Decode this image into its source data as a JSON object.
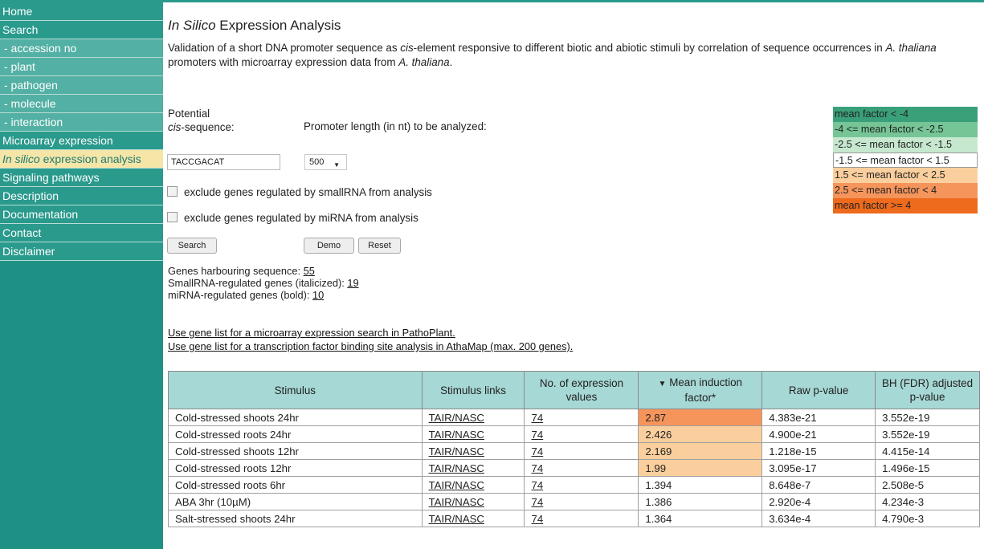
{
  "nav": {
    "items": [
      {
        "label": "Home",
        "sub": false
      },
      {
        "label": "Search",
        "sub": false
      },
      {
        "label": "- accession no",
        "sub": true
      },
      {
        "label": "- plant",
        "sub": true
      },
      {
        "label": "- pathogen",
        "sub": true
      },
      {
        "label": "- molecule",
        "sub": true
      },
      {
        "label": "- interaction",
        "sub": true
      },
      {
        "label": "Microarray expression",
        "sub": false
      },
      {
        "label_italic": "In silico",
        "label_rest": " expression analysis",
        "active": true
      },
      {
        "label": "Signaling pathways",
        "sub": false
      },
      {
        "label": "Description",
        "sub": false
      },
      {
        "label": "Documentation",
        "sub": false
      },
      {
        "label": "Contact",
        "sub": false
      },
      {
        "label": "Disclaimer",
        "sub": false
      }
    ]
  },
  "page": {
    "title_italic": "In Silico",
    "title_rest": " Expression Analysis",
    "intro": {
      "p1": "Validation of a short DNA promoter sequence as ",
      "p2": "cis",
      "p3": "-element responsive to different biotic and abiotic stimuli by correlation of sequence occurrences in ",
      "p4": "A. thaliana",
      "p5": " promoters with microarray expression data from ",
      "p6": "A. thaliana",
      "p7": "."
    }
  },
  "form": {
    "seq_label_1": "Potential",
    "seq_label_2_italic": "cis",
    "seq_label_2_rest": "-sequence:",
    "length_label": "Promoter length (in nt) to be analyzed:",
    "sequence_value": "TACCGACAT",
    "length_value": "500",
    "exclude_smallrna": "exclude genes regulated by smallRNA from analysis",
    "exclude_mirna": "exclude genes regulated by miRNA from analysis",
    "search_btn": "Search",
    "demo_btn": "Demo",
    "reset_btn": "Reset"
  },
  "stats": {
    "harbouring_label": "Genes harbouring sequence: ",
    "harbouring_value": "55",
    "smallrna_label": "SmallRNA-regulated genes (italicized): ",
    "smallrna_value": "19",
    "mirna_label": "miRNA-regulated genes (bold): ",
    "mirna_value": "10"
  },
  "links": {
    "pathoplant": "Use gene list for a microarray expression search in PathoPlant.",
    "athamap": "Use gene list for a transcription factor binding site analysis in AthaMap (max. 200 genes)."
  },
  "legend": [
    {
      "label": "mean factor < -4",
      "color": "#3aa07a"
    },
    {
      "label": "-4   <= mean factor < -2.5",
      "color": "#76c596"
    },
    {
      "label": "-2.5 <= mean factor < -1.5",
      "color": "#c6e8cf"
    },
    {
      "label": "-1.5 <= mean factor <  1.5",
      "color": "#ffffff"
    },
    {
      "label": "1.5 <= mean factor <  2.5",
      "color": "#fbcf9d"
    },
    {
      "label": "2.5 <= mean factor <  4",
      "color": "#f5955c"
    },
    {
      "label": "mean factor >= 4",
      "color": "#ee6a1c"
    }
  ],
  "table": {
    "headers": [
      "Stimulus",
      "Stimulus links",
      "No. of expression values",
      "Mean induction factor*",
      "Raw p-value",
      "BH (FDR) adjusted p-value"
    ],
    "rows": [
      {
        "stimulus": "Cold-stressed shoots 24hr",
        "link": "TAIR/NASC",
        "n": "74",
        "mean": "2.87",
        "mean_color": "#f5955c",
        "raw": "4.383e-21",
        "bh": "3.552e-19"
      },
      {
        "stimulus": "Cold-stressed roots 24hr",
        "link": "TAIR/NASC",
        "n": "74",
        "mean": "2.426",
        "mean_color": "#fbcf9d",
        "raw": "4.900e-21",
        "bh": "3.552e-19"
      },
      {
        "stimulus": "Cold-stressed shoots 12hr",
        "link": "TAIR/NASC",
        "n": "74",
        "mean": "2.169",
        "mean_color": "#fbcf9d",
        "raw": "1.218e-15",
        "bh": "4.415e-14"
      },
      {
        "stimulus": "Cold-stressed roots 12hr",
        "link": "TAIR/NASC",
        "n": "74",
        "mean": "1.99",
        "mean_color": "#fbcf9d",
        "raw": "3.095e-17",
        "bh": "1.496e-15"
      },
      {
        "stimulus": "Cold-stressed roots 6hr",
        "link": "TAIR/NASC",
        "n": "74",
        "mean": "1.394",
        "mean_color": "#ffffff",
        "raw": "8.648e-7",
        "bh": "2.508e-5"
      },
      {
        "stimulus": "ABA 3hr (10µM)",
        "link": "TAIR/NASC",
        "n": "74",
        "mean": "1.386",
        "mean_color": "#ffffff",
        "raw": "2.920e-4",
        "bh": "4.234e-3"
      },
      {
        "stimulus": "Salt-stressed shoots 24hr",
        "link": "TAIR/NASC",
        "n": "74",
        "mean": "1.364",
        "mean_color": "#ffffff",
        "raw": "3.634e-4",
        "bh": "4.790e-3"
      }
    ]
  }
}
